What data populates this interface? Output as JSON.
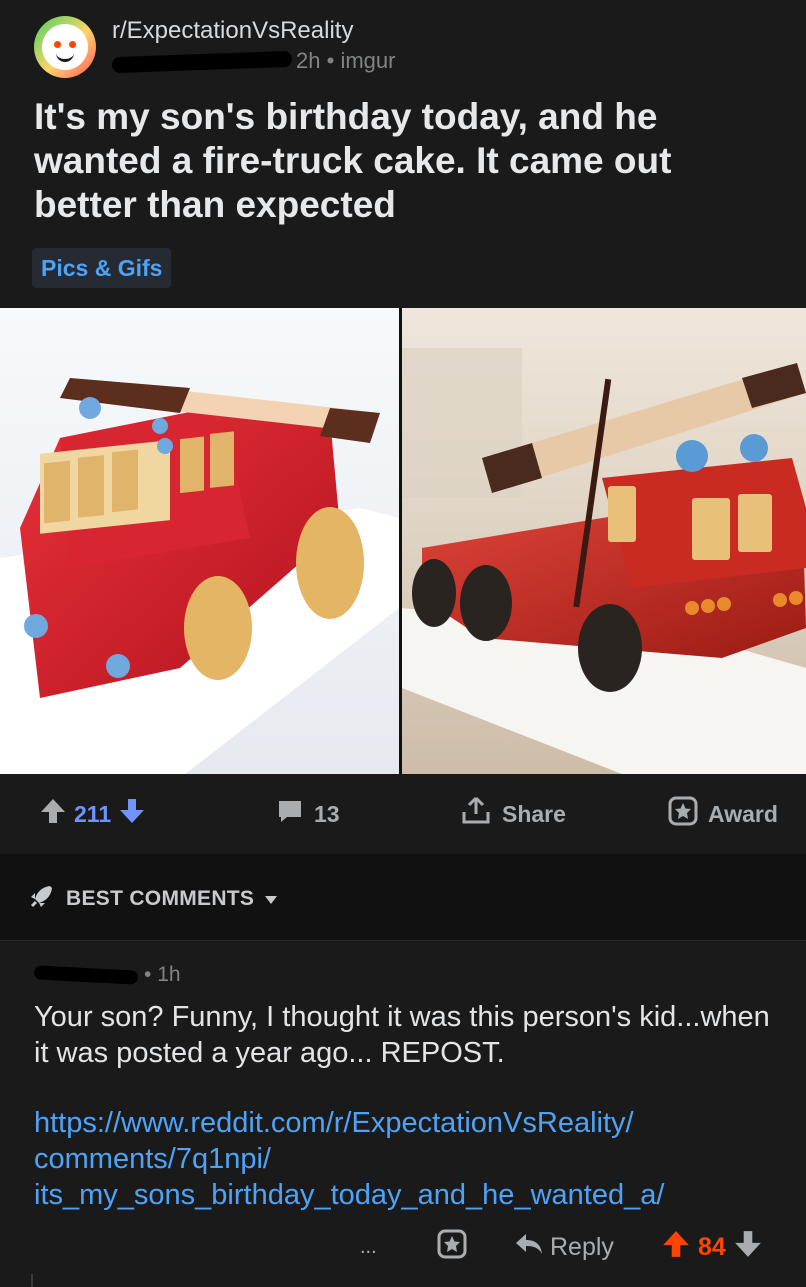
{
  "post": {
    "subreddit": "r/ExpectationVsReality",
    "age": "2h",
    "separator": "•",
    "domain": "imgur",
    "title": "It's my son's birthday today, and he wanted a fire-truck cake. It came out better than expected",
    "flair": "Pics & Gifs"
  },
  "actions": {
    "votes": "211",
    "comments": "13",
    "share": "Share",
    "award": "Award"
  },
  "comments_section": {
    "sort_label": "BEST COMMENTS"
  },
  "comment": {
    "age": "1h",
    "separator": "•",
    "body": "Your son? Funny, I thought it was this person's kid...when it was posted a year ago... REPOST.",
    "link_lines": [
      "https://www.reddit.com/r/ExpectationVsReality/",
      "comments/7q1npi/",
      "its_my_sons_birthday_today_and_he_wanted_a/"
    ],
    "more": "...",
    "reply": "Reply",
    "score": "84"
  },
  "colors": {
    "background": "#111112",
    "card": "#1a1a1b",
    "upvote_blue": "#7193ff",
    "upvote_orange": "#ff4500",
    "link_blue": "#4fa3f7"
  },
  "icons": [
    "reddit-snoo-icon",
    "upvote-icon",
    "downvote-icon",
    "comment-icon",
    "share-icon",
    "award-icon",
    "rocket-icon",
    "caret-down-icon",
    "more-icon",
    "reply-icon"
  ]
}
